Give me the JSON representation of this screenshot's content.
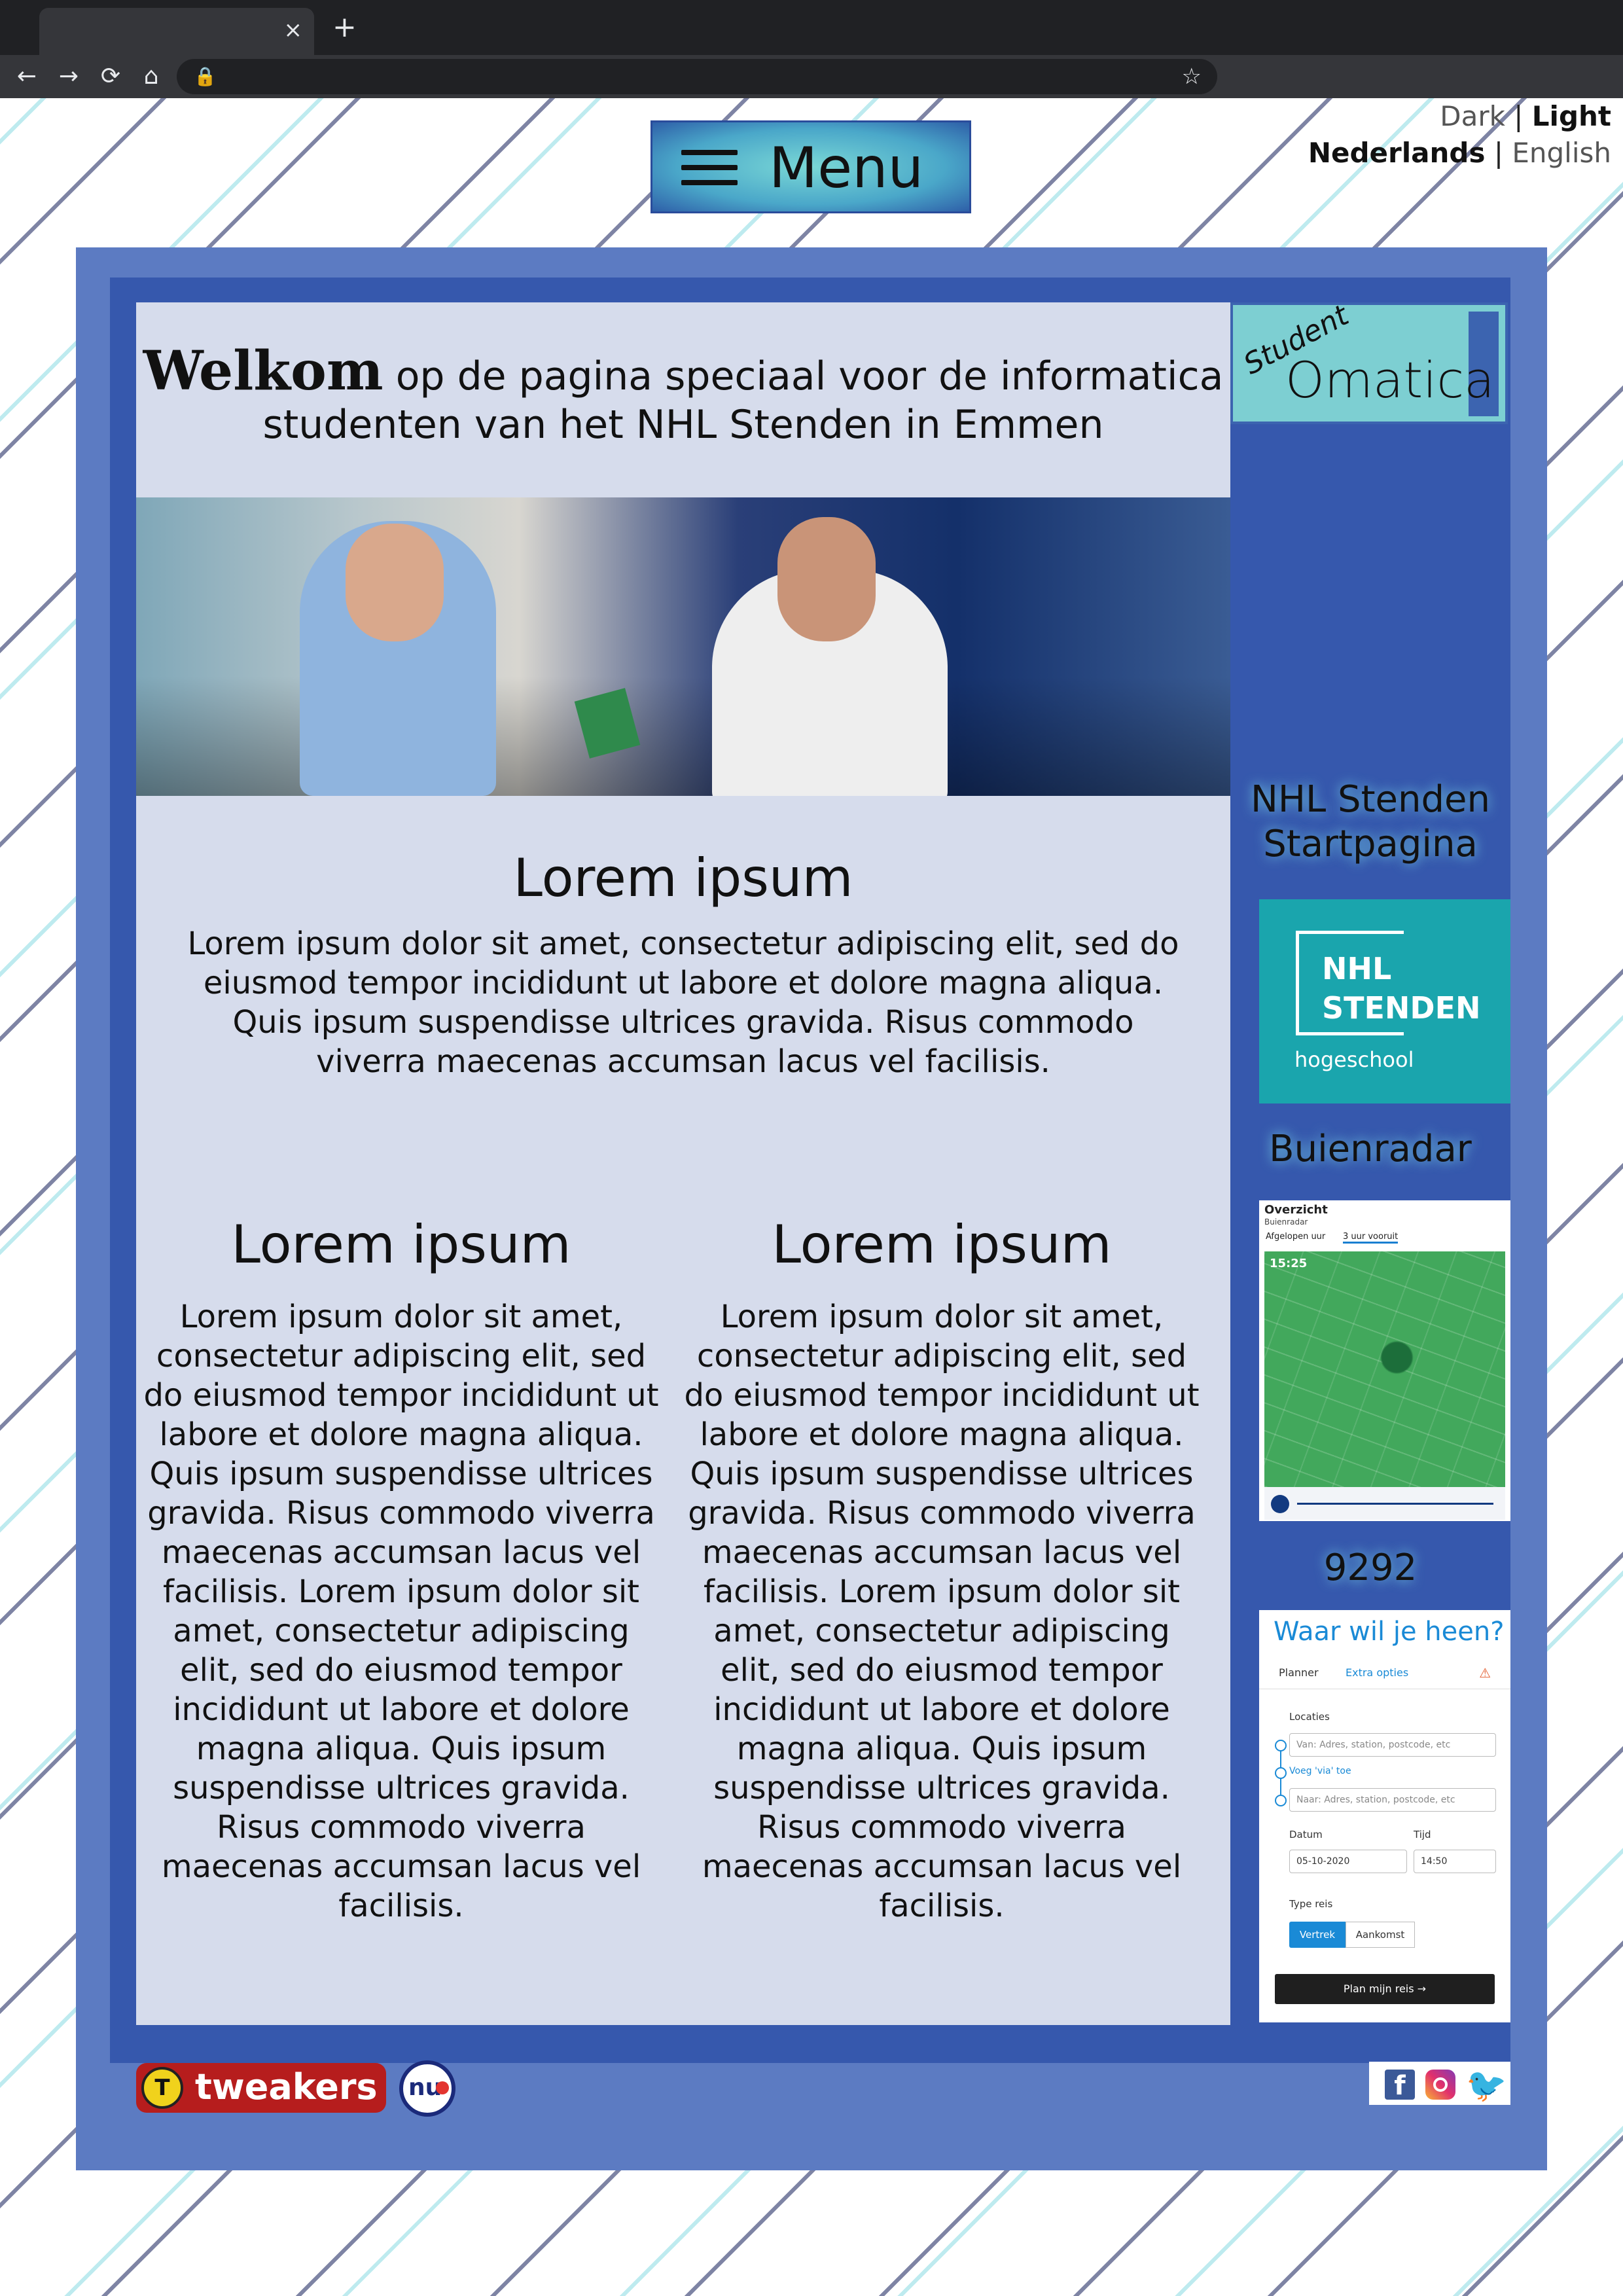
{
  "browser": {
    "tab_close": "×",
    "new_tab": "+",
    "back": "←",
    "forward": "→",
    "reload": "⟳",
    "home": "⌂",
    "lock": "🔒",
    "star": "☆"
  },
  "header": {
    "menu_label": "Menu",
    "theme": {
      "dark": "Dark",
      "separator": "|",
      "light": "Light",
      "active": "Light"
    },
    "language": {
      "nl": "Nederlands",
      "separator": "|",
      "en": "English",
      "active": "Nederlands"
    }
  },
  "intro": {
    "welcome_bold": "Welkom",
    "welcome_rest": " op de pagina speciaal voor de informatica studenten van het NHL Stenden in Emmen"
  },
  "sections": {
    "main": {
      "heading": "Lorem ipsum",
      "body": "Lorem ipsum dolor sit amet, consectetur adipiscing elit, sed do eiusmod tempor incididunt ut labore et dolore magna aliqua. Quis ipsum suspendisse ultrices gravida. Risus commodo viverra maecenas accumsan lacus vel facilisis."
    },
    "left": {
      "heading": "Lorem ipsum",
      "body": "Lorem ipsum dolor sit amet, consectetur adipiscing elit, sed do eiusmod tempor incididunt ut labore et dolore magna aliqua. Quis ipsum suspendisse ultrices gravida. Risus commodo viverra maecenas accumsan lacus vel facilisis. Lorem ipsum dolor sit amet, consectetur adipiscing elit, sed do eiusmod tempor incididunt ut labore et dolore magna aliqua. Quis ipsum suspendisse ultrices gravida. Risus commodo viverra maecenas accumsan lacus vel facilisis."
    },
    "right": {
      "heading": "Lorem ipsum",
      "body": "Lorem ipsum dolor sit amet, consectetur adipiscing elit, sed do eiusmod tempor incididunt ut labore et dolore magna aliqua. Quis ipsum suspendisse ultrices gravida. Risus commodo viverra maecenas accumsan lacus vel facilisis. Lorem ipsum dolor sit amet, consectetur adipiscing elit, sed do eiusmod tempor incididunt ut labore et dolore magna aliqua. Quis ipsum suspendisse ultrices gravida. Risus commodo viverra maecenas accumsan lacus vel facilisis."
    }
  },
  "sidebar": {
    "logo": {
      "student": "Student",
      "omatica": "Omatica"
    },
    "nhl_title": "NHL Stenden Startpagina",
    "nhl_logo": {
      "line1": "NHL",
      "line2": "STENDEN",
      "sub": "hogeschool"
    },
    "buienradar_title": "Buienradar",
    "buienradar": {
      "heading": "Overzicht",
      "subheading": "Buienradar",
      "tab_past": "Afgelopen uur",
      "tab_future": "3 uur vooruit",
      "time": "15:25"
    },
    "ninetwo_title": "9292",
    "ninetwo": {
      "question": "Waar wil je heen?",
      "tab_planner": "Planner",
      "tab_extra": "Extra opties",
      "warning": "⚠",
      "locaties": "Locaties",
      "from_placeholder": "Van: Adres, station, postcode, etc",
      "via": "Voeg 'via' toe",
      "to_placeholder": "Naar: Adres, station, postcode, etc",
      "datum_label": "Datum",
      "datum": "05-10-2020",
      "tijd_label": "Tijd",
      "tijd": "14:50",
      "type_label": "Type reis",
      "vertrek": "Vertrek",
      "aankomst": "Aankomst",
      "plan": "Plan mijn reis →"
    }
  },
  "footer": {
    "tweakers": "tweakers",
    "tweakers_icon": "T",
    "nu": "nu",
    "facebook": "f",
    "twitter": "🐦"
  }
}
